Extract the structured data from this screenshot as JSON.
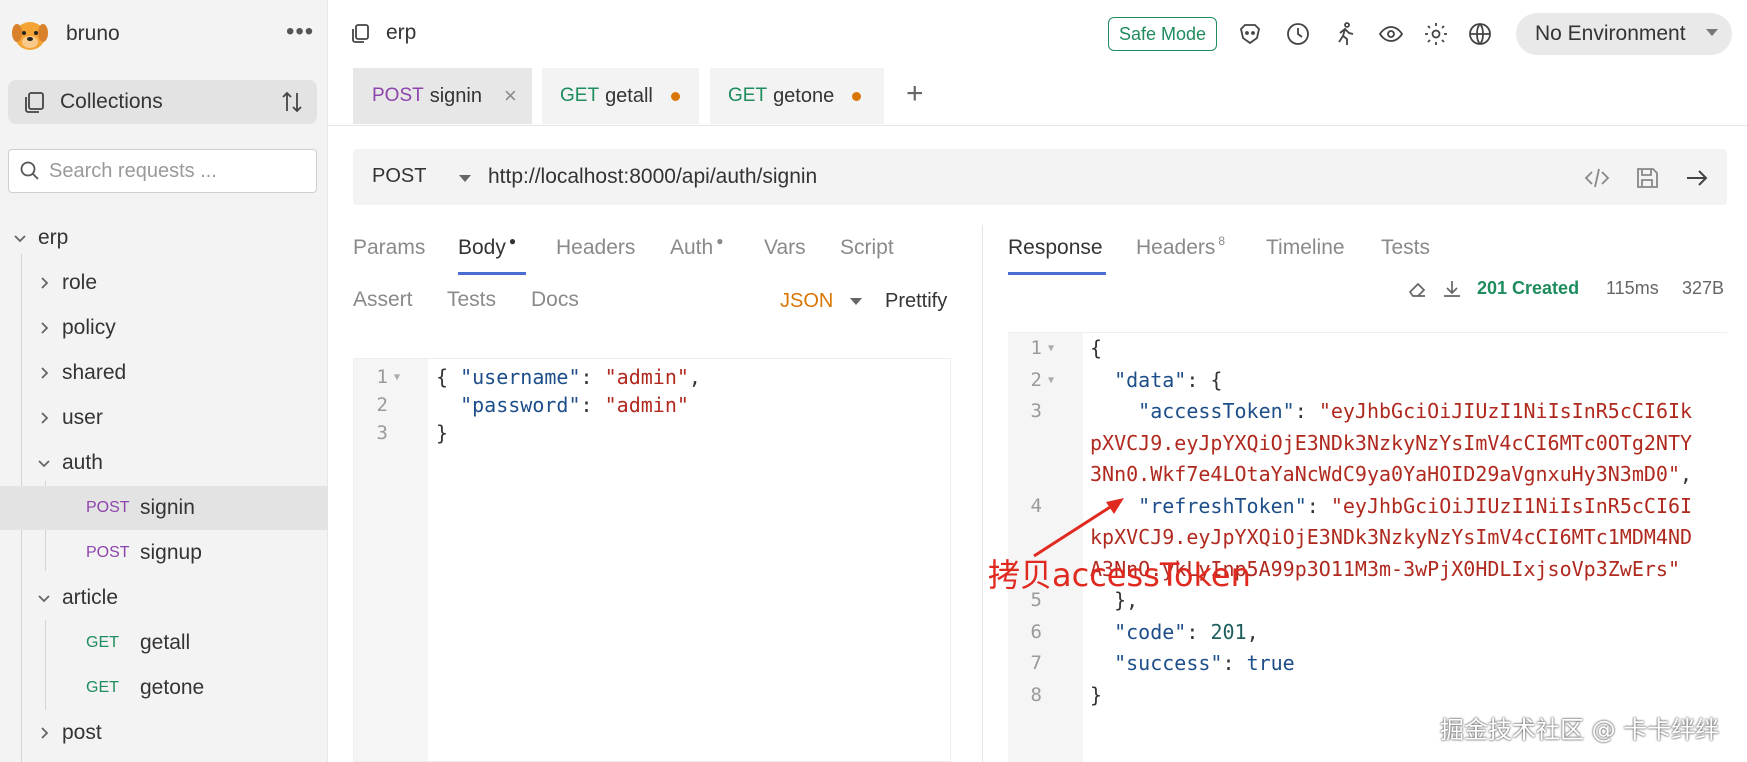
{
  "app": {
    "name": "bruno",
    "menu_icon": "ellipsis-icon"
  },
  "sidebar": {
    "collections_label": "Collections",
    "search_placeholder": "Search requests ...",
    "collection": {
      "name": "erp",
      "folders": [
        "role",
        "policy",
        "shared",
        "user",
        "auth",
        "article",
        "post"
      ],
      "auth_requests": [
        {
          "method": "POST",
          "name": "signin"
        },
        {
          "method": "POST",
          "name": "signup"
        }
      ],
      "article_requests": [
        {
          "method": "GET",
          "name": "getall"
        },
        {
          "method": "GET",
          "name": "getone"
        }
      ]
    }
  },
  "header": {
    "collection_title": "erp",
    "safe_mode": "Safe Mode",
    "environment": "No Environment",
    "icons": [
      "bruno-icon",
      "history-icon",
      "runner-icon",
      "eye-icon",
      "gear-icon",
      "globe-icon"
    ]
  },
  "tabs": [
    {
      "method": "POST",
      "name": "signin",
      "active": true
    },
    {
      "method": "GET",
      "name": "getall",
      "unsaved": true
    },
    {
      "method": "GET",
      "name": "getone",
      "unsaved": true
    }
  ],
  "request": {
    "method": "POST",
    "url": "http://localhost:8000/api/auth/signin",
    "tabs": [
      "Params",
      "Body",
      "Headers",
      "Auth",
      "Vars",
      "Script",
      "Assert",
      "Tests",
      "Docs"
    ],
    "body_mode": "JSON",
    "prettify": "Prettify",
    "body_lines": [
      {
        "n": "1",
        "parts": [
          [
            "p",
            "{ "
          ],
          [
            "k",
            "\"username\""
          ],
          [
            "p",
            ": "
          ],
          [
            "s",
            "\"admin\""
          ],
          [
            "p",
            ","
          ]
        ]
      },
      {
        "n": "2",
        "parts": [
          [
            "p",
            "  "
          ],
          [
            "k",
            "\"password\""
          ],
          [
            "p",
            ": "
          ],
          [
            "s",
            "\"admin\""
          ]
        ]
      },
      {
        "n": "3",
        "parts": [
          [
            "p",
            "}"
          ]
        ]
      }
    ]
  },
  "response": {
    "tabs": [
      "Response",
      "Headers",
      "Timeline",
      "Tests"
    ],
    "headers_count": "8",
    "status": "201 Created",
    "time": "115ms",
    "size": "327B",
    "lines": [
      {
        "n": "1",
        "parts": [
          [
            "p",
            "{"
          ]
        ]
      },
      {
        "n": "2",
        "parts": [
          [
            "p",
            "  "
          ],
          [
            "k",
            "\"data\""
          ],
          [
            "p",
            ": {"
          ]
        ]
      },
      {
        "n": "3",
        "parts": [
          [
            "p",
            "    "
          ],
          [
            "k",
            "\"accessToken\""
          ],
          [
            "p",
            ": "
          ],
          [
            "s",
            "\"eyJhbGciOiJIUzI1NiIsInR5cCI6Ik"
          ]
        ]
      },
      {
        "n": "",
        "parts": [
          [
            "s",
            "pXVCJ9.eyJpYXQiOjE3NDk3NzkyNzYsImV4cCI6MTc0OTg2NTY"
          ]
        ]
      },
      {
        "n": "",
        "parts": [
          [
            "s",
            "3Nn0.Wkf7e4LOtaYaNcWdC9ya0YaHOID29aVgnxuHy3N3mD0\""
          ],
          [
            "p",
            ","
          ]
        ]
      },
      {
        "n": "4",
        "parts": [
          [
            "p",
            "    "
          ],
          [
            "k",
            "\"refreshToken\""
          ],
          [
            "p",
            ": "
          ],
          [
            "s",
            "\"eyJhbGciOiJIUzI1NiIsInR5cCI6I"
          ]
        ]
      },
      {
        "n": "",
        "parts": [
          [
            "s",
            "kpXVCJ9.eyJpYXQiOjE3NDk3NzkyNzYsImV4cCI6MTc1MDM4ND"
          ]
        ]
      },
      {
        "n": "",
        "parts": [
          [
            "s",
            "A3NnO.ykLyInp5A99p3O11M3m-3wPjX0HDLIxjsoVp3ZwErs\""
          ]
        ]
      },
      {
        "n": "5",
        "parts": [
          [
            "p",
            "  },"
          ]
        ]
      },
      {
        "n": "6",
        "parts": [
          [
            "p",
            "  "
          ],
          [
            "k",
            "\"code\""
          ],
          [
            "p",
            ": "
          ],
          [
            "n",
            "201"
          ],
          [
            "p",
            ","
          ]
        ]
      },
      {
        "n": "7",
        "parts": [
          [
            "p",
            "  "
          ],
          [
            "k",
            "\"success\""
          ],
          [
            "p",
            ": "
          ],
          [
            "kw",
            "true"
          ]
        ]
      },
      {
        "n": "8",
        "parts": [
          [
            "p",
            "}"
          ]
        ]
      }
    ]
  },
  "annotation": "拷贝accessToken",
  "watermark": "掘金技术社区 @ 卡卡绊绊",
  "colors": {
    "post": "#8e44ad",
    "get": "#1f8c5d",
    "status_ok": "#1f8c5d",
    "accent": "#4b6cd1",
    "annotation": "#e02a20"
  }
}
